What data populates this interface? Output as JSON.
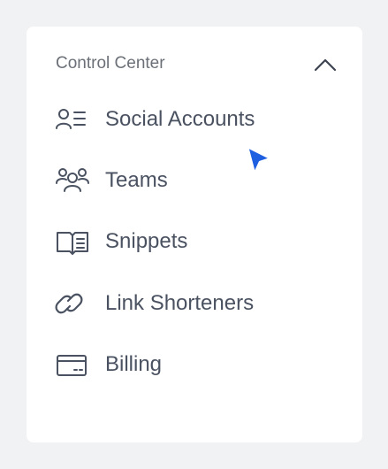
{
  "panel": {
    "section_title": "Control Center",
    "collapse_icon": "chevron-up-icon"
  },
  "menu": {
    "items": [
      {
        "label": "Social Accounts",
        "icon": "user-list-icon",
        "active": true
      },
      {
        "label": "Teams",
        "icon": "users-group-icon",
        "active": false
      },
      {
        "label": "Snippets",
        "icon": "book-open-icon",
        "active": false
      },
      {
        "label": "Link Shorteners",
        "icon": "link-icon",
        "active": false
      },
      {
        "label": "Billing",
        "icon": "credit-card-icon",
        "active": false
      }
    ]
  },
  "colors": {
    "accent": "#2563d9",
    "text": "#4a5261",
    "muted": "#6b7078",
    "active_bg": "#f0f2f6"
  }
}
